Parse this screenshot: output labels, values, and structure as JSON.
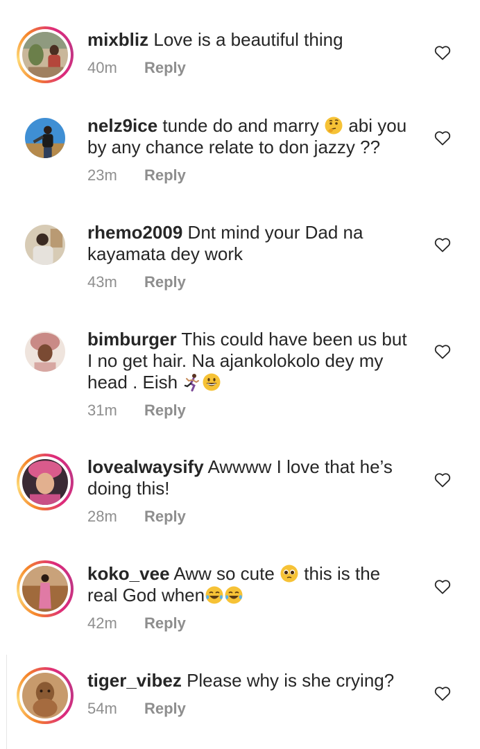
{
  "comments": [
    {
      "username": "mixbliz",
      "text_1": "Love is a beautiful thing",
      "time": "40m",
      "reply": "Reply",
      "avatar_icon": "avatar-photo",
      "story_ring": true
    },
    {
      "username": "nelz9ice",
      "text_1": "tunde do and marry",
      "text_2": "abi you by any chance relate to don jazzy ??",
      "emoji": "thinking-face",
      "time": "23m",
      "reply": "Reply",
      "avatar_icon": "avatar-photo",
      "story_ring": false
    },
    {
      "username": "rhemo2009",
      "text_1": "Dnt mind your Dad na kayamata dey work",
      "time": "43m",
      "reply": "Reply",
      "avatar_icon": "avatar-photo",
      "story_ring": false
    },
    {
      "username": "bimburger",
      "text_1": "This could have been us but I no get hair. Na ajankolokolo dey my head . Eish",
      "emojis": [
        "woman-running",
        "grinning-face"
      ],
      "time": "31m",
      "reply": "Reply",
      "avatar_icon": "avatar-photo",
      "story_ring": false
    },
    {
      "username": "lovealwaysify",
      "text_1": "Awwww I love that he’s doing this!",
      "time": "28m",
      "reply": "Reply",
      "avatar_icon": "avatar-photo",
      "story_ring": true
    },
    {
      "username": "koko_vee",
      "text_1": "Aww so cute",
      "text_2": "this is the real God when",
      "emojis": [
        "pleading-face",
        "tears-of-joy",
        "tears-of-joy"
      ],
      "time": "42m",
      "reply": "Reply",
      "avatar_icon": "avatar-photo",
      "story_ring": true
    },
    {
      "username": "tiger_vibez",
      "text_1": "Please why is she crying?",
      "time": "54m",
      "reply": "Reply",
      "avatar_icon": "avatar-photo",
      "story_ring": true
    }
  ],
  "colors": {
    "text": "#262626",
    "secondary": "#8e8e8e",
    "story_ring_start": "#f58529",
    "story_ring_end": "#dd2a7b"
  },
  "icons": {
    "like": "heart-outline-icon"
  }
}
